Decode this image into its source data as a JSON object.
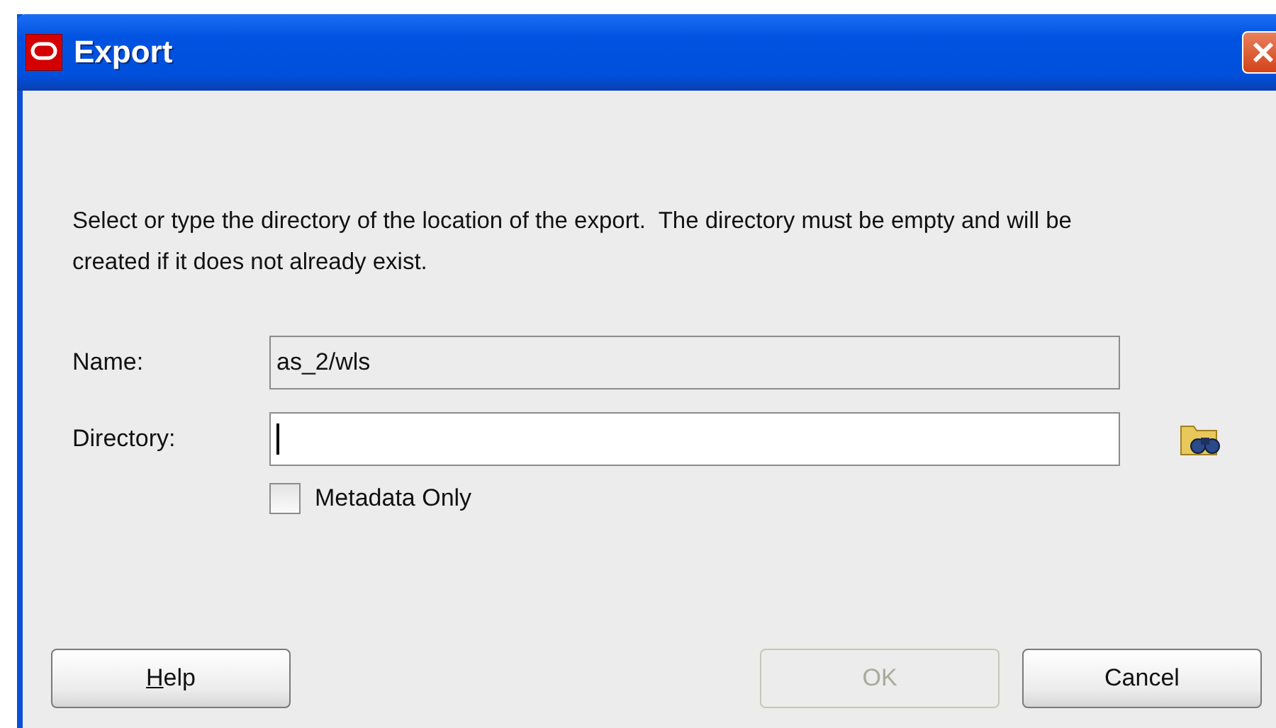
{
  "window": {
    "title": "Export"
  },
  "instructions": "Select or type the directory of the location of the export.  The directory must be empty and will be created if it does not already exist.",
  "fields": [
    {
      "label": "Name:",
      "value": "as_2/wls",
      "disabled": true,
      "focused": false
    },
    {
      "label": "Directory:",
      "disabled": false,
      "focused": true,
      "browse": true
    }
  ],
  "metadata_only": {
    "label": "Metadata Only",
    "checked": false
  },
  "buttons": [
    {
      "label": "Help",
      "first_letter_underlined": true,
      "disabled": false
    },
    {
      "label": "OK",
      "first_letter_underlined": false,
      "disabled": true
    },
    {
      "label": "Cancel",
      "first_letter_underlined": false,
      "disabled": false
    }
  ]
}
